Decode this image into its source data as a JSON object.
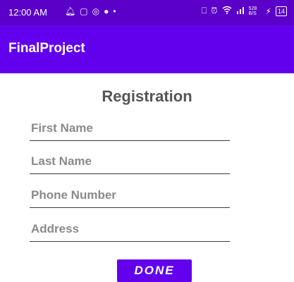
{
  "status_bar": {
    "time": "12:00 AM",
    "left_icons": [
      "notification-bell-icon",
      "chat-icon",
      "instagram-icon",
      "messenger-icon",
      "dot-icon"
    ],
    "right_icons": [
      "vibrate-icon",
      "alarm-icon",
      "wifi-icon",
      "signal-icon",
      "data-speed-icon",
      "charging-icon"
    ],
    "data_speed": "528 B/S",
    "battery": "14"
  },
  "app_bar": {
    "title": "FinalProject"
  },
  "form": {
    "title": "Registration",
    "fields": [
      {
        "placeholder": "First Name",
        "value": ""
      },
      {
        "placeholder": "Last Name",
        "value": ""
      },
      {
        "placeholder": "Phone Number",
        "value": ""
      },
      {
        "placeholder": "Address",
        "value": ""
      }
    ],
    "done_label": "DONE"
  },
  "colors": {
    "primary": "#6200ee",
    "primary_dark": "#5a00c8"
  }
}
